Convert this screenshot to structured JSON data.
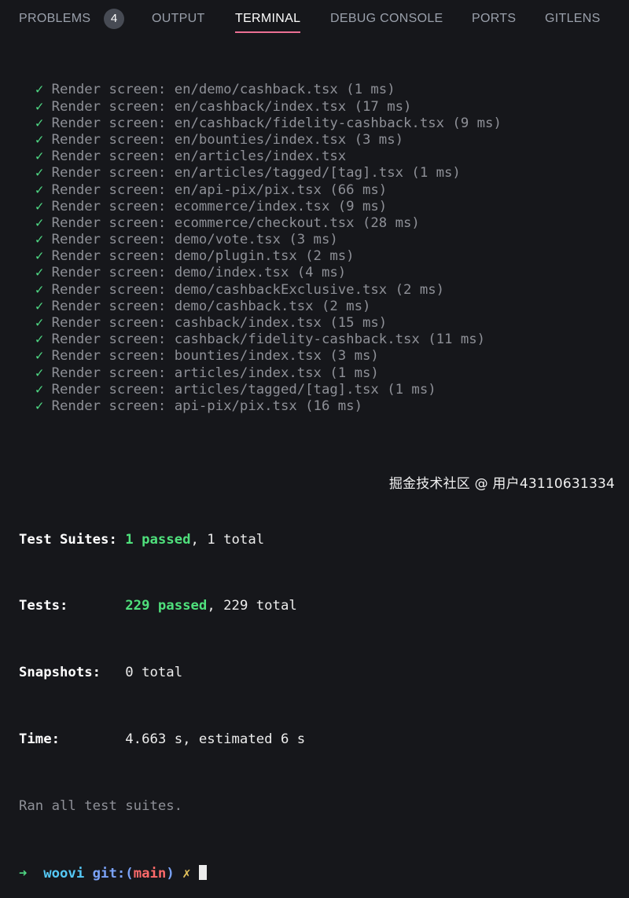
{
  "tabs": {
    "problems": "PROBLEMS",
    "problems_count": "4",
    "output": "OUTPUT",
    "terminal": "TERMINAL",
    "debug_console": "DEBUG CONSOLE",
    "ports": "PORTS",
    "gitlens": "GITLENS"
  },
  "terminal": {
    "check_glyph": "✓",
    "render_lines": [
      "Render screen: en/demo/cashback.tsx (1 ms)",
      "Render screen: en/cashback/index.tsx (17 ms)",
      "Render screen: en/cashback/fidelity-cashback.tsx (9 ms)",
      "Render screen: en/bounties/index.tsx (3 ms)",
      "Render screen: en/articles/index.tsx",
      "Render screen: en/articles/tagged/[tag].tsx (1 ms)",
      "Render screen: en/api-pix/pix.tsx (66 ms)",
      "Render screen: ecommerce/index.tsx (9 ms)",
      "Render screen: ecommerce/checkout.tsx (28 ms)",
      "Render screen: demo/vote.tsx (3 ms)",
      "Render screen: demo/plugin.tsx (2 ms)",
      "Render screen: demo/index.tsx (4 ms)",
      "Render screen: demo/cashbackExclusive.tsx (2 ms)",
      "Render screen: demo/cashback.tsx (2 ms)",
      "Render screen: cashback/index.tsx (15 ms)",
      "Render screen: cashback/fidelity-cashback.tsx (11 ms)",
      "Render screen: bounties/index.tsx (3 ms)",
      "Render screen: articles/index.tsx (1 ms)",
      "Render screen: articles/tagged/[tag].tsx (1 ms)",
      "Render screen: api-pix/pix.tsx (16 ms)"
    ],
    "summary": {
      "suites_label": "Test Suites:",
      "suites_passed": "1 passed",
      "suites_total": ", 1 total",
      "tests_label": "Tests:",
      "tests_passed": "229 passed",
      "tests_total": ", 229 total",
      "snapshots_label": "Snapshots:",
      "snapshots_value": "0 total",
      "time_label": "Time:",
      "time_value": "4.663 s, estimated 6 s",
      "ran_all": "Ran all test suites."
    },
    "prompt": {
      "arrow": "➜",
      "dir": "woovi",
      "git_label": "git:(",
      "branch": "main",
      "git_close": ")",
      "dirty": "✗"
    }
  },
  "watermark": "掘金技术社区 @ 用户43110631334",
  "colors": {
    "background": "#16171b",
    "active_tab_underline": "#ec6f94",
    "check_green": "#4fd884",
    "passed_green": "#4fe07c",
    "branch_red": "#ff6a6a",
    "prompt_cyan": "#55c8f5"
  }
}
